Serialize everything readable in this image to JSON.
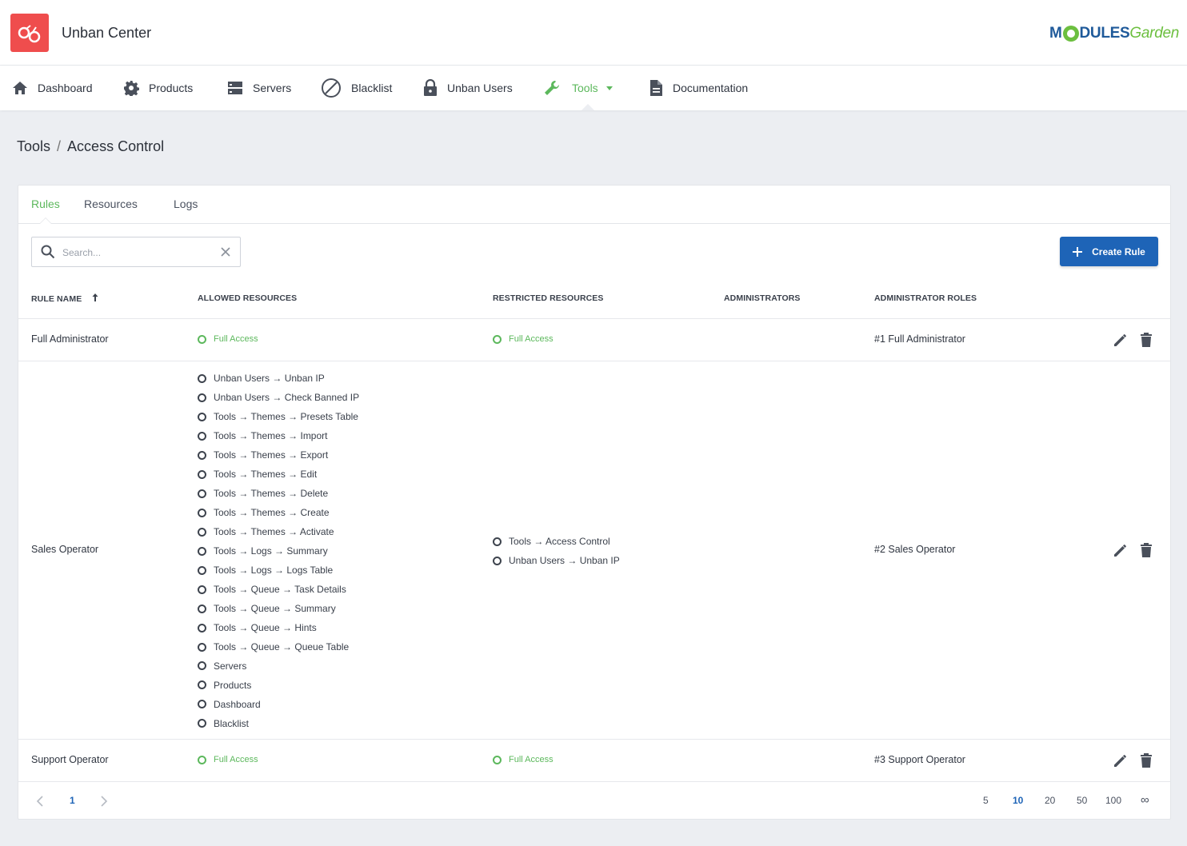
{
  "app": {
    "title": "Unban Center",
    "brand_left": "M",
    "brand_mid": "DULES",
    "brand_right": "Garden"
  },
  "nav": {
    "items": [
      {
        "label": "Dashboard",
        "icon": "home-icon"
      },
      {
        "label": "Products",
        "icon": "gear-icon"
      },
      {
        "label": "Servers",
        "icon": "server-icon"
      },
      {
        "label": "Blacklist",
        "icon": "ban-icon"
      },
      {
        "label": "Unban Users",
        "icon": "lock-icon"
      },
      {
        "label": "Tools",
        "icon": "wrench-icon",
        "active": true
      },
      {
        "label": "Documentation",
        "icon": "document-icon"
      }
    ]
  },
  "breadcrumb": {
    "parent": "Tools",
    "separator": "/",
    "current": "Access Control"
  },
  "tabs": [
    {
      "label": "Rules",
      "active": true
    },
    {
      "label": "Resources"
    },
    {
      "label": "Logs"
    }
  ],
  "search": {
    "placeholder": "Search...",
    "value": ""
  },
  "create_button": {
    "label": "Create Rule"
  },
  "table": {
    "headers": {
      "rule_name": "RULE NAME",
      "allowed": "ALLOWED RESOURCES",
      "restricted": "RESTRICTED RESOURCES",
      "administrators": "ADMINISTRATORS",
      "roles": "ADMINISTRATOR ROLES"
    },
    "sort": {
      "column": "RULE NAME",
      "direction": "ascending"
    },
    "rows": [
      {
        "name": "Full Administrator",
        "allowed": [
          "Full Access"
        ],
        "restricted": [
          "Full Access"
        ],
        "administrators": "",
        "roles": "#1 Full Administrator"
      },
      {
        "name": "Sales Operator",
        "allowed": [
          "Unban Users → Unban IP",
          "Unban Users → Check Banned IP",
          "Tools → Themes → Presets Table",
          "Tools → Themes → Import",
          "Tools → Themes → Export",
          "Tools → Themes → Edit",
          "Tools → Themes → Delete",
          "Tools → Themes → Create",
          "Tools → Themes → Activate",
          "Tools → Logs → Summary",
          "Tools → Logs → Logs Table",
          "Tools → Queue → Task Details",
          "Tools → Queue → Summary",
          "Tools → Queue → Hints",
          "Tools → Queue → Queue Table",
          "Servers",
          "Products",
          "Dashboard",
          "Blacklist"
        ],
        "restricted": [
          "Tools → Access Control",
          "Unban Users → Unban IP"
        ],
        "administrators": "",
        "roles": "#2 Sales Operator"
      },
      {
        "name": "Support Operator",
        "allowed": [
          "Full Access"
        ],
        "restricted": [
          "Full Access"
        ],
        "administrators": "",
        "roles": "#3 Support Operator"
      }
    ]
  },
  "pagination": {
    "current_page": "1",
    "page_sizes": [
      "5",
      "10",
      "20",
      "50",
      "100",
      "∞"
    ],
    "selected_size": "10"
  },
  "colors": {
    "accent_green": "#5cb85c",
    "primary_blue": "#1e64b7",
    "logo_red": "#ef4d4d"
  }
}
